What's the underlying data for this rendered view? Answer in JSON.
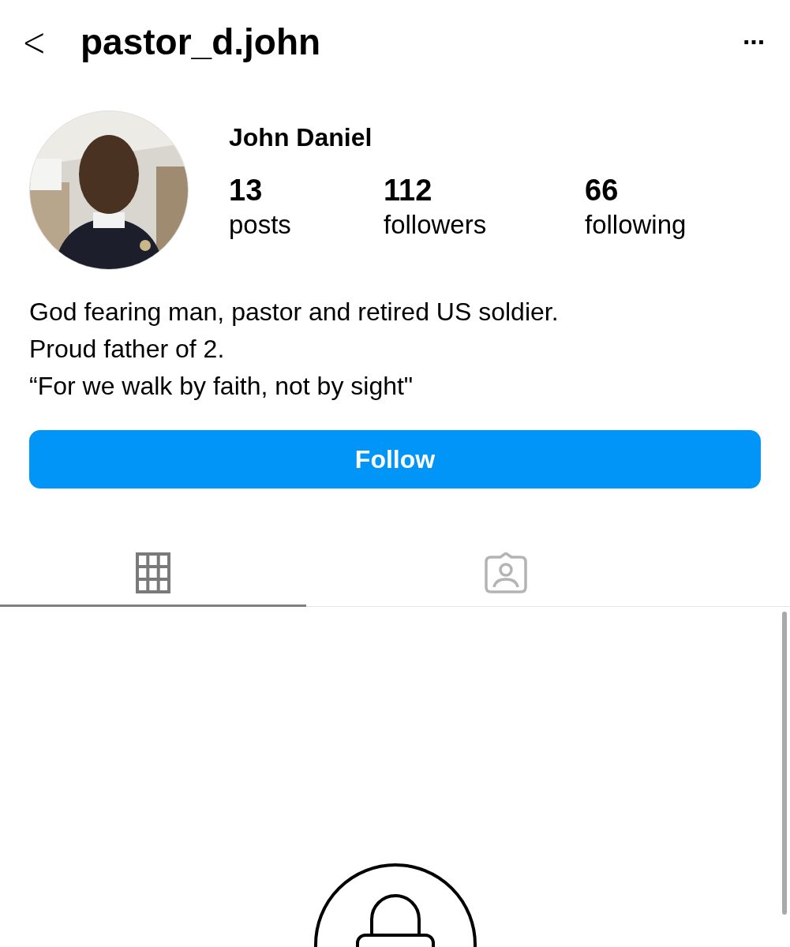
{
  "header": {
    "back": "<",
    "username": "pastor_d.john",
    "more": "···"
  },
  "profile": {
    "name": "John Daniel",
    "stats": [
      {
        "value": "13",
        "label": "posts"
      },
      {
        "value": "112",
        "label": "followers"
      },
      {
        "value": "66",
        "label": "following"
      }
    ],
    "bio": [
      "God fearing man, pastor and retired US soldier.",
      "Proud father of 2.",
      "“For we walk by faith, not by sight\""
    ]
  },
  "follow_button": "Follow",
  "tabs": [
    {
      "kind": "grid",
      "selected": true
    },
    {
      "kind": "tagged",
      "selected": false
    }
  ],
  "private_notice": {
    "kind": "lock"
  }
}
